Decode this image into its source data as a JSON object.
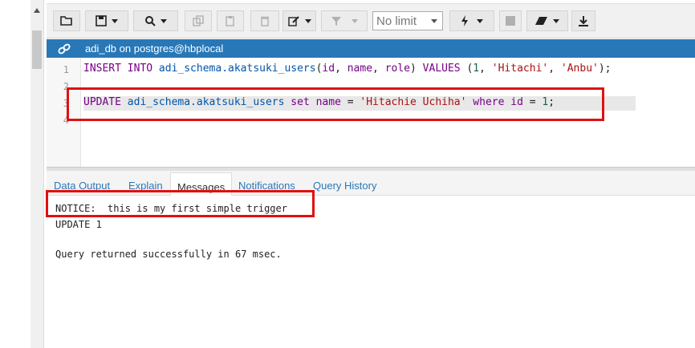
{
  "toolbar": {
    "limit_value": "No limit"
  },
  "connection": {
    "label": "adi_db on postgres@hbplocal"
  },
  "editor": {
    "line_numbers": [
      "1",
      "2",
      "3",
      "4"
    ],
    "line1": {
      "kw1": "INSERT INTO",
      "ident1": "adi_schema.",
      "ident2": "akatsuki_users",
      "punct1": "(",
      "kw2": "id",
      "punct2": ", ",
      "kw3": "name",
      "punct3": ", ",
      "kw4": "role",
      "punct4": ") ",
      "kw5": "VALUES",
      "punct5": " (",
      "num1": "1",
      "punct6": ", ",
      "str1": "'Hitachi'",
      "punct7": ", ",
      "str2": "'Anbu'",
      "punct8": ");"
    },
    "line3": {
      "kw1": "UPDATE",
      "ident1": " adi_schema.",
      "ident2": "akatsuki_users",
      "kw2": " set name",
      "punct1": " = ",
      "str1": "'Hitachie Uchiha'",
      "kw3": " where id",
      "punct2": " = ",
      "num1": "1",
      "punct3": ";"
    }
  },
  "tabs": [
    {
      "label": "Data Output",
      "active": false
    },
    {
      "label": "Explain",
      "active": false
    },
    {
      "label": "Messages",
      "active": true
    },
    {
      "label": "Notifications",
      "active": false
    },
    {
      "label": "Query History",
      "active": false
    }
  ],
  "messages": {
    "line1": "NOTICE:  this is my first simple trigger",
    "line2": "UPDATE 1",
    "line3": "Query returned successfully in 67 msec."
  },
  "colors": {
    "connection_bar": "#2878b8",
    "annotation_box": "#e01010",
    "keyword": "#770088",
    "identifier": "#0055aa",
    "string": "#aa1111",
    "number": "#116644"
  }
}
